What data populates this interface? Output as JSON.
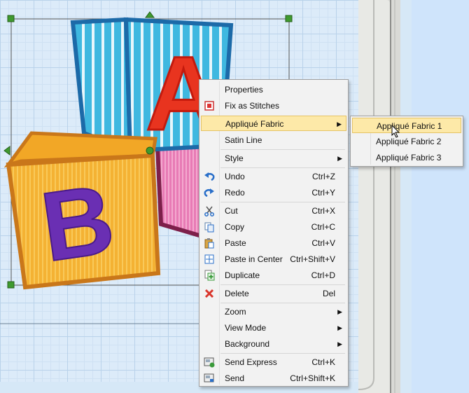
{
  "context_menu": {
    "items": [
      {
        "label": "Properties",
        "icon": "properties-icon"
      },
      {
        "label": "Fix as Stitches",
        "icon": "fix-stitches-icon"
      },
      {
        "label": "Appliqué Fabric",
        "submenu": true
      },
      {
        "label": "Satin Line"
      },
      {
        "label": "Style",
        "submenu": true
      },
      {
        "label": "Undo",
        "shortcut": "Ctrl+Z",
        "icon": "undo-icon"
      },
      {
        "label": "Redo",
        "shortcut": "Ctrl+Y",
        "icon": "redo-icon"
      },
      {
        "label": "Cut",
        "shortcut": "Ctrl+X",
        "icon": "scissors-icon"
      },
      {
        "label": "Copy",
        "shortcut": "Ctrl+C",
        "icon": "copy-icon"
      },
      {
        "label": "Paste",
        "shortcut": "Ctrl+V",
        "icon": "paste-icon"
      },
      {
        "label": "Paste in Center",
        "shortcut": "Ctrl+Shift+V",
        "icon": "paste-center-icon"
      },
      {
        "label": "Duplicate",
        "shortcut": "Ctrl+D",
        "icon": "duplicate-icon"
      },
      {
        "label": "Delete",
        "shortcut": "Del",
        "icon": "delete-icon"
      },
      {
        "label": "Zoom",
        "submenu": true
      },
      {
        "label": "View Mode",
        "submenu": true
      },
      {
        "label": "Background",
        "submenu": true
      },
      {
        "label": "Send Express",
        "shortcut": "Ctrl+K",
        "icon": "send-express-icon"
      },
      {
        "label": "Send",
        "shortcut": "Ctrl+Shift+K",
        "icon": "send-icon"
      }
    ],
    "highlighted": "Appliqué Fabric"
  },
  "submenu": {
    "items": [
      {
        "label": "Appliqué Fabric 1"
      },
      {
        "label": "Appliqué Fabric 2"
      },
      {
        "label": "Appliqué Fabric 3"
      }
    ],
    "highlighted": "Appliqué Fabric 1"
  },
  "canvas": {
    "design_letters": [
      "A",
      "B"
    ]
  },
  "colors": {
    "highlight": "#fde9a8",
    "menu_bg": "#f2f2f2",
    "grid_bg": "#dcebf9",
    "delete_red": "#d9352b",
    "undo_blue": "#2a6fc9"
  }
}
